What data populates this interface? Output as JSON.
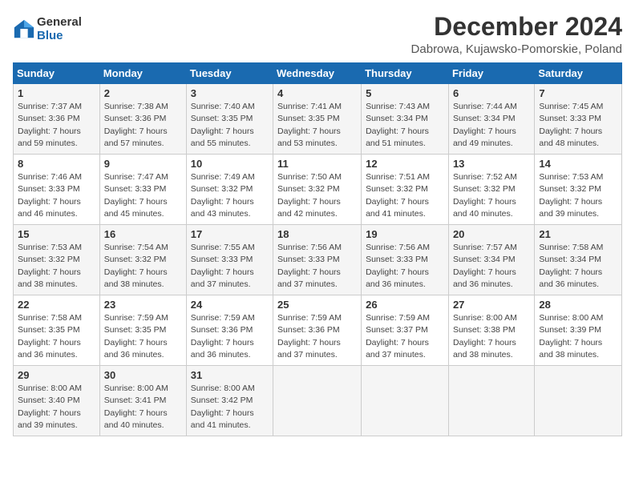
{
  "logo": {
    "general": "General",
    "blue": "Blue"
  },
  "title": "December 2024",
  "location": "Dabrowa, Kujawsko-Pomorskie, Poland",
  "days_header": [
    "Sunday",
    "Monday",
    "Tuesday",
    "Wednesday",
    "Thursday",
    "Friday",
    "Saturday"
  ],
  "weeks": [
    [
      {
        "day": "1",
        "sunrise": "Sunrise: 7:37 AM",
        "sunset": "Sunset: 3:36 PM",
        "daylight": "Daylight: 7 hours and 59 minutes."
      },
      {
        "day": "2",
        "sunrise": "Sunrise: 7:38 AM",
        "sunset": "Sunset: 3:36 PM",
        "daylight": "Daylight: 7 hours and 57 minutes."
      },
      {
        "day": "3",
        "sunrise": "Sunrise: 7:40 AM",
        "sunset": "Sunset: 3:35 PM",
        "daylight": "Daylight: 7 hours and 55 minutes."
      },
      {
        "day": "4",
        "sunrise": "Sunrise: 7:41 AM",
        "sunset": "Sunset: 3:35 PM",
        "daylight": "Daylight: 7 hours and 53 minutes."
      },
      {
        "day": "5",
        "sunrise": "Sunrise: 7:43 AM",
        "sunset": "Sunset: 3:34 PM",
        "daylight": "Daylight: 7 hours and 51 minutes."
      },
      {
        "day": "6",
        "sunrise": "Sunrise: 7:44 AM",
        "sunset": "Sunset: 3:34 PM",
        "daylight": "Daylight: 7 hours and 49 minutes."
      },
      {
        "day": "7",
        "sunrise": "Sunrise: 7:45 AM",
        "sunset": "Sunset: 3:33 PM",
        "daylight": "Daylight: 7 hours and 48 minutes."
      }
    ],
    [
      {
        "day": "8",
        "sunrise": "Sunrise: 7:46 AM",
        "sunset": "Sunset: 3:33 PM",
        "daylight": "Daylight: 7 hours and 46 minutes."
      },
      {
        "day": "9",
        "sunrise": "Sunrise: 7:47 AM",
        "sunset": "Sunset: 3:33 PM",
        "daylight": "Daylight: 7 hours and 45 minutes."
      },
      {
        "day": "10",
        "sunrise": "Sunrise: 7:49 AM",
        "sunset": "Sunset: 3:32 PM",
        "daylight": "Daylight: 7 hours and 43 minutes."
      },
      {
        "day": "11",
        "sunrise": "Sunrise: 7:50 AM",
        "sunset": "Sunset: 3:32 PM",
        "daylight": "Daylight: 7 hours and 42 minutes."
      },
      {
        "day": "12",
        "sunrise": "Sunrise: 7:51 AM",
        "sunset": "Sunset: 3:32 PM",
        "daylight": "Daylight: 7 hours and 41 minutes."
      },
      {
        "day": "13",
        "sunrise": "Sunrise: 7:52 AM",
        "sunset": "Sunset: 3:32 PM",
        "daylight": "Daylight: 7 hours and 40 minutes."
      },
      {
        "day": "14",
        "sunrise": "Sunrise: 7:53 AM",
        "sunset": "Sunset: 3:32 PM",
        "daylight": "Daylight: 7 hours and 39 minutes."
      }
    ],
    [
      {
        "day": "15",
        "sunrise": "Sunrise: 7:53 AM",
        "sunset": "Sunset: 3:32 PM",
        "daylight": "Daylight: 7 hours and 38 minutes."
      },
      {
        "day": "16",
        "sunrise": "Sunrise: 7:54 AM",
        "sunset": "Sunset: 3:32 PM",
        "daylight": "Daylight: 7 hours and 38 minutes."
      },
      {
        "day": "17",
        "sunrise": "Sunrise: 7:55 AM",
        "sunset": "Sunset: 3:33 PM",
        "daylight": "Daylight: 7 hours and 37 minutes."
      },
      {
        "day": "18",
        "sunrise": "Sunrise: 7:56 AM",
        "sunset": "Sunset: 3:33 PM",
        "daylight": "Daylight: 7 hours and 37 minutes."
      },
      {
        "day": "19",
        "sunrise": "Sunrise: 7:56 AM",
        "sunset": "Sunset: 3:33 PM",
        "daylight": "Daylight: 7 hours and 36 minutes."
      },
      {
        "day": "20",
        "sunrise": "Sunrise: 7:57 AM",
        "sunset": "Sunset: 3:34 PM",
        "daylight": "Daylight: 7 hours and 36 minutes."
      },
      {
        "day": "21",
        "sunrise": "Sunrise: 7:58 AM",
        "sunset": "Sunset: 3:34 PM",
        "daylight": "Daylight: 7 hours and 36 minutes."
      }
    ],
    [
      {
        "day": "22",
        "sunrise": "Sunrise: 7:58 AM",
        "sunset": "Sunset: 3:35 PM",
        "daylight": "Daylight: 7 hours and 36 minutes."
      },
      {
        "day": "23",
        "sunrise": "Sunrise: 7:59 AM",
        "sunset": "Sunset: 3:35 PM",
        "daylight": "Daylight: 7 hours and 36 minutes."
      },
      {
        "day": "24",
        "sunrise": "Sunrise: 7:59 AM",
        "sunset": "Sunset: 3:36 PM",
        "daylight": "Daylight: 7 hours and 36 minutes."
      },
      {
        "day": "25",
        "sunrise": "Sunrise: 7:59 AM",
        "sunset": "Sunset: 3:36 PM",
        "daylight": "Daylight: 7 hours and 37 minutes."
      },
      {
        "day": "26",
        "sunrise": "Sunrise: 7:59 AM",
        "sunset": "Sunset: 3:37 PM",
        "daylight": "Daylight: 7 hours and 37 minutes."
      },
      {
        "day": "27",
        "sunrise": "Sunrise: 8:00 AM",
        "sunset": "Sunset: 3:38 PM",
        "daylight": "Daylight: 7 hours and 38 minutes."
      },
      {
        "day": "28",
        "sunrise": "Sunrise: 8:00 AM",
        "sunset": "Sunset: 3:39 PM",
        "daylight": "Daylight: 7 hours and 38 minutes."
      }
    ],
    [
      {
        "day": "29",
        "sunrise": "Sunrise: 8:00 AM",
        "sunset": "Sunset: 3:40 PM",
        "daylight": "Daylight: 7 hours and 39 minutes."
      },
      {
        "day": "30",
        "sunrise": "Sunrise: 8:00 AM",
        "sunset": "Sunset: 3:41 PM",
        "daylight": "Daylight: 7 hours and 40 minutes."
      },
      {
        "day": "31",
        "sunrise": "Sunrise: 8:00 AM",
        "sunset": "Sunset: 3:42 PM",
        "daylight": "Daylight: 7 hours and 41 minutes."
      },
      null,
      null,
      null,
      null
    ]
  ]
}
